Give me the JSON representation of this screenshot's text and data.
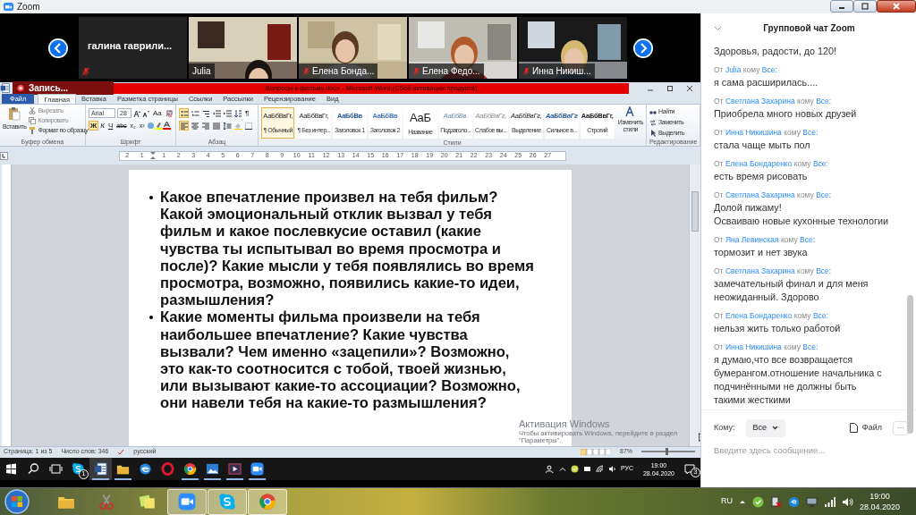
{
  "window": {
    "title": "Zoom"
  },
  "gallery": {
    "tiles": [
      {
        "name": "галина гаврили...",
        "kind": "name",
        "muted": true
      },
      {
        "name": "Julia",
        "kind": "video",
        "muted": false
      },
      {
        "name": "Елена Бонда...",
        "kind": "video",
        "muted": true
      },
      {
        "name": "Елена Федо...",
        "kind": "video",
        "muted": true
      },
      {
        "name": "Инна Никиш...",
        "kind": "video",
        "muted": true
      }
    ]
  },
  "word": {
    "title": "Вопросы к фильму.docx - Microsoft Word (Сбой активации продукта)",
    "recording": "Запись...",
    "tabs": [
      {
        "label": "Файл",
        "kind": "file",
        "selected": false
      },
      {
        "label": "Главная",
        "kind": "tab",
        "selected": true
      },
      {
        "label": "Вставка",
        "kind": "tab",
        "selected": false
      },
      {
        "label": "Разметка страницы",
        "kind": "tab",
        "selected": false
      },
      {
        "label": "Ссылки",
        "kind": "tab",
        "selected": false
      },
      {
        "label": "Рассылки",
        "kind": "tab",
        "selected": false
      },
      {
        "label": "Рецензирование",
        "kind": "tab",
        "selected": false
      },
      {
        "label": "Вид",
        "kind": "tab",
        "selected": false
      }
    ],
    "clipboard": {
      "label": "Буфер обмена",
      "paste": "Вставить",
      "tools": [
        {
          "label": "Вырезать",
          "kind": "cut",
          "disabled": true
        },
        {
          "label": "Копировать",
          "kind": "copy",
          "disabled": true
        },
        {
          "label": "Формат по образцу",
          "kind": "painter",
          "disabled": false
        }
      ]
    },
    "font": {
      "label": "Шрифт",
      "family": "Arial",
      "size": "28",
      "case": "Aa",
      "buttons": [
        "Ж",
        "К",
        "Ч",
        "abc",
        "x₂",
        "x²"
      ]
    },
    "paragraph": {
      "label": "Абзац",
      "mark": "¶",
      "buttons": [
        {
          "kind": "bullets",
          "selected": true
        },
        {
          "kind": "numbering",
          "selected": false
        },
        {
          "kind": "multilevel",
          "selected": false
        },
        {
          "kind": "outdent",
          "selected": false
        },
        {
          "kind": "indent",
          "selected": false
        },
        {
          "kind": "sort",
          "selected": false
        },
        {
          "kind": "align-left",
          "selected": true
        },
        {
          "kind": "align-center",
          "selected": false
        },
        {
          "kind": "align-right",
          "selected": false
        },
        {
          "kind": "justify",
          "selected": false
        },
        {
          "kind": "spacing",
          "selected": false
        },
        {
          "kind": "shading",
          "selected": false
        },
        {
          "kind": "borders",
          "selected": false
        }
      ]
    },
    "styles": {
      "label": "Стили",
      "items": [
        {
          "preview": "АаБбВвГг,",
          "name": "¶ Обычный",
          "selected": true
        },
        {
          "preview": "АаБбВвГг,",
          "name": "¶ Без интер...",
          "selected": false
        },
        {
          "preview": "АаБбВв",
          "name": "Заголовок 1",
          "selected": false
        },
        {
          "preview": "АаБбВв",
          "name": "Заголовок 2",
          "selected": false
        },
        {
          "preview": "АаБ",
          "name": "Название",
          "selected": false
        },
        {
          "preview": "АаБбВв.",
          "name": "Подзаголо...",
          "selected": false
        },
        {
          "preview": "АаБбВвГг,",
          "name": "Слабое вы...",
          "selected": false
        },
        {
          "preview": "АаБбВвГг,",
          "name": "Выделение",
          "selected": false
        },
        {
          "preview": "АаБбВвГг",
          "name": "Сильное в...",
          "selected": false
        },
        {
          "preview": "АаБбВвГг,",
          "name": "Строгий",
          "selected": false
        }
      ]
    },
    "change_styles": "Изменить стили",
    "editing": {
      "label": "Редактирование",
      "items": [
        "Найти",
        "Заменить",
        "Выделить"
      ]
    },
    "ruler": [
      "2",
      "1",
      "1",
      "2",
      "3",
      "4",
      "5",
      "6",
      "7",
      "8",
      "9",
      "10",
      "11",
      "12",
      "13",
      "14",
      "15",
      "16",
      "17",
      "18",
      "19",
      "20",
      "21",
      "22",
      "23",
      "24",
      "25",
      "26",
      "27"
    ],
    "document": {
      "bullets": [
        "Какое впечатление произвел на тебя фильм? Какой эмоциональный отклик вызвал у тебя фильм и какое послевкусие оставил (какие чувства ты испытывал во время просмотра и после)? Какие мысли у тебя появлялись во время просмотра, возможно, появились какие-то идеи, размышления?",
        "Какие моменты фильма произвели на тебя наибольшее впечатление? Какие чувства вызвали? Чем именно «зацепили»? Возможно, это как-то соотносится с тобой, твоей жизнью, или вызывают какие-то ассоциации? Возможно, они навели тебя на какие-то размышления?"
      ]
    },
    "activation": {
      "title": "Активация Windows",
      "text": "Чтобы активировать Windows, перейдите в раздел \"Параметры\"."
    },
    "status": {
      "page": "Страница: 1 из 5",
      "words": "Число слов: 346",
      "language": "русский",
      "zoom": "87%",
      "zoom_slider": {
        "level": 0.47
      }
    }
  },
  "inner_taskbar": {
    "apps": [
      {
        "kind": "skype",
        "open": false,
        "badge": "1"
      },
      {
        "kind": "word",
        "open": true
      },
      {
        "kind": "explorer",
        "open": true
      },
      {
        "kind": "edge",
        "open": false
      },
      {
        "kind": "opera",
        "open": false
      },
      {
        "kind": "chrome",
        "open": true
      },
      {
        "kind": "photos",
        "open": true
      },
      {
        "kind": "video",
        "open": true
      },
      {
        "kind": "zoom",
        "open": true
      }
    ],
    "language": "РУС",
    "time": "19:00",
    "date": "28.04.2020",
    "notifications": "3"
  },
  "chat": {
    "title": "Групповой чат Zoom",
    "messages": [
      {
        "lines": [
          "Здоровья, радости, до 120!"
        ]
      },
      {
        "from_label": "От",
        "sender": "Julia",
        "to_label": "кому",
        "recipient": "Все:",
        "lines": [
          "я сама расширилась...."
        ]
      },
      {
        "from_label": "От",
        "sender": "Светлана Захарина",
        "to_label": "кому",
        "recipient": "Все:",
        "lines": [
          "Приобрела много новых друзей"
        ]
      },
      {
        "from_label": "От",
        "sender": "Инна Никишина",
        "to_label": "кому",
        "recipient": "Все:",
        "lines": [
          "стала чаще мыть пол"
        ]
      },
      {
        "from_label": "От",
        "sender": "Елена Бондаренко",
        "to_label": "кому",
        "recipient": "Все:",
        "lines": [
          "есть время рисовать"
        ]
      },
      {
        "from_label": "От",
        "sender": "Светлана Захарина",
        "to_label": "кому",
        "recipient": "Все:",
        "lines": [
          "Долой пижаму!",
          "Осваиваю новые кухонные технологии"
        ]
      },
      {
        "from_label": "От",
        "sender": "Яна Левинская",
        "to_label": "кому",
        "recipient": "Все:",
        "lines": [
          "тормозит и нет звука"
        ]
      },
      {
        "from_label": "От",
        "sender": "Светлана Захарина",
        "to_label": "кому",
        "recipient": "Все:",
        "lines": [
          "замечательный финал и для меня",
          "неожиданный. Здорово"
        ]
      },
      {
        "from_label": "От",
        "sender": "Елена Бондаренко",
        "to_label": "кому",
        "recipient": "Все:",
        "lines": [
          "нельзя жить только работой"
        ]
      },
      {
        "from_label": "От",
        "sender": "Инна Никишина",
        "to_label": "кому",
        "recipient": "Все:",
        "lines": [
          "я думаю,что все возвращается",
          "бумерангом.отношение начальника с",
          "подчинёнными не должны быть",
          "такими жесткими"
        ]
      }
    ],
    "to_label": "Кому:",
    "to_value": "Все",
    "file": "Файл",
    "more": "···",
    "placeholder": "Введите здесь сообщение..."
  },
  "taskbar": {
    "apps": [
      {
        "kind": "explorer",
        "open": false
      },
      {
        "kind": "scissors",
        "open": false
      },
      {
        "kind": "notes",
        "open": false
      },
      {
        "kind": "zoom",
        "open": true
      },
      {
        "kind": "skype",
        "open": true
      },
      {
        "kind": "chrome",
        "open": true
      }
    ],
    "language": "RU",
    "time": "19:00",
    "date": "28.04.2020"
  }
}
